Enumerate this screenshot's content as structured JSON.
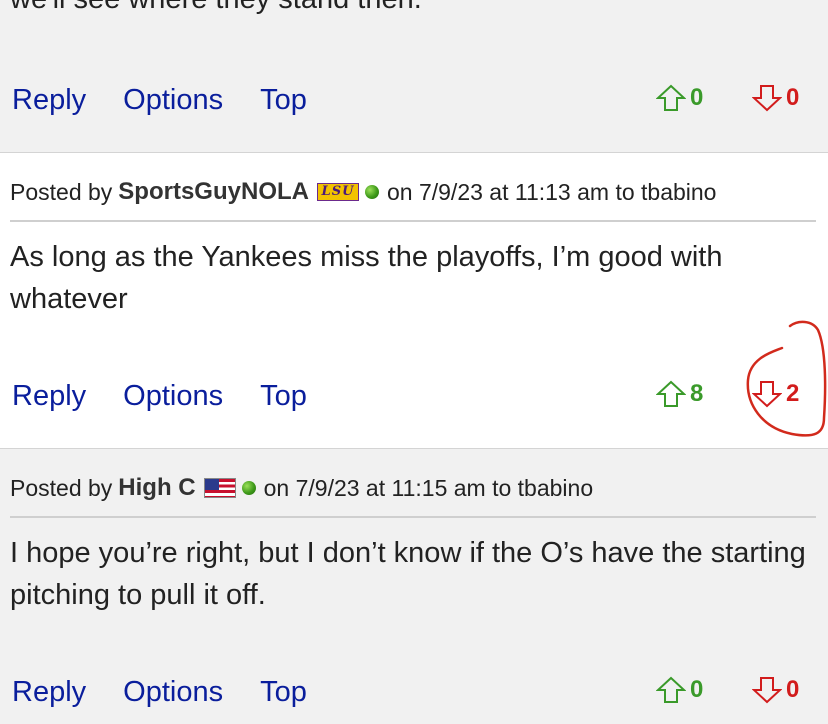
{
  "top_post": {
    "partial_text": "we'll see where they stand then.",
    "actions": {
      "reply": "Reply",
      "options": "Options",
      "top": "Top"
    },
    "upvotes": "0",
    "downvotes": "0"
  },
  "posts": [
    {
      "posted_by": "Posted by",
      "user": "SportsGuyNOLA",
      "badge": "LSU",
      "meta": "on 7/9/23 at 11:13 am to tbabino",
      "body": "As long as the Yankees miss the playoffs, I’m good with whatever",
      "actions": {
        "reply": "Reply",
        "options": "Options",
        "top": "Top"
      },
      "upvotes": "8",
      "downvotes": "2"
    },
    {
      "posted_by": "Posted by",
      "user": "High C",
      "meta": "on 7/9/23 at 11:15 am to tbabino",
      "body": "I hope you’re right, but I don’t know if the O’s have the starting pitching to pull it off.",
      "actions": {
        "reply": "Reply",
        "options": "Options",
        "top": "Top"
      },
      "upvotes": "0",
      "downvotes": "0"
    }
  ],
  "colors": {
    "link": "#0a1e9c",
    "upvote": "#3a9a2a",
    "downvote": "#d21c1c",
    "annotation": "#d22a1c"
  }
}
